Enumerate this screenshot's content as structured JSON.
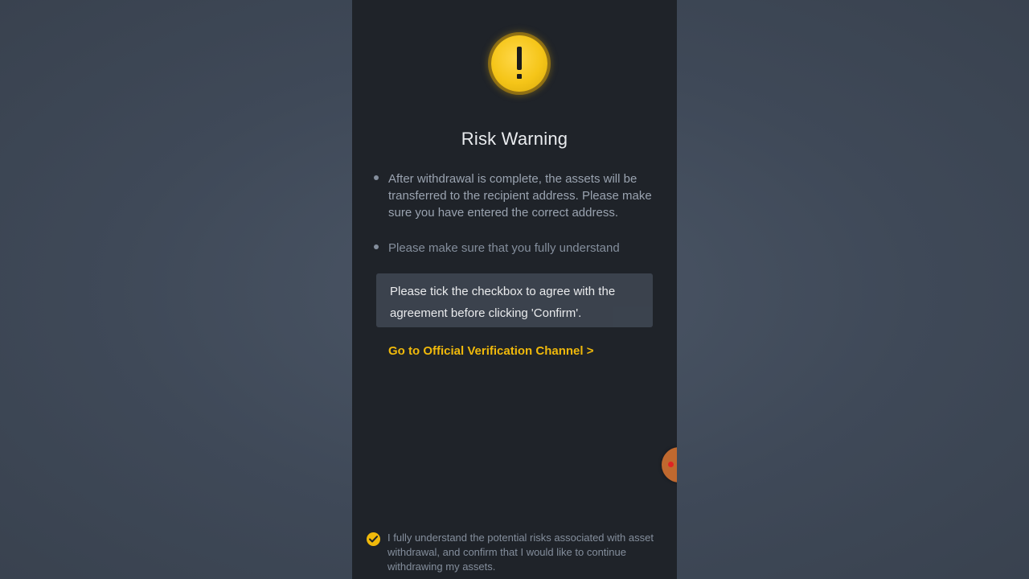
{
  "dialog": {
    "title": "Risk Warning",
    "icon": "exclamation-warning-icon",
    "bullets": [
      "After withdrawal is complete, the assets will be transferred to the recipient address. Please make sure you have entered the correct address.",
      "Please make sure that you fully understand"
    ],
    "verification_link": "Go to Official Verification Channel >",
    "agreement": {
      "checked": true,
      "text": "I fully understand the potential risks associated with asset withdrawal, and confirm that I would like to continue withdrawing my assets."
    }
  },
  "toast": {
    "line1": "Please tick the checkbox to agree with the",
    "line2": "agreement before clicking 'Confirm'."
  },
  "colors": {
    "accent": "#f0b90b",
    "background": "#1f2329",
    "toast_background": "#3c444f"
  }
}
